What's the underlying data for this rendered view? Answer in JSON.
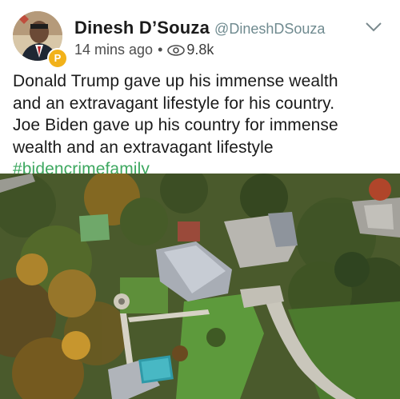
{
  "author": {
    "display_name": "Dinesh D’Souza",
    "handle": "@DineshDSouza",
    "badge_letter": "P"
  },
  "meta": {
    "time_ago": "14 mins ago",
    "separator": "•",
    "views": "9.8k"
  },
  "post": {
    "lines": [
      "Donald Trump gave up his immense wealth",
      "and an extravagant lifestyle for his country.",
      "Joe Biden gave up his country for immense",
      "wealth and an extravagant lifestyle"
    ],
    "hashtag": "#bidencrimefamily"
  },
  "icons": {
    "menu": "chevron-down-icon",
    "views": "eye-icon",
    "badge": "parler-badge-icon"
  },
  "colors": {
    "name": "#1b1b1b",
    "handle": "#6f8a8f",
    "hashtag": "#3ea860",
    "badge": "#f2b21a"
  }
}
